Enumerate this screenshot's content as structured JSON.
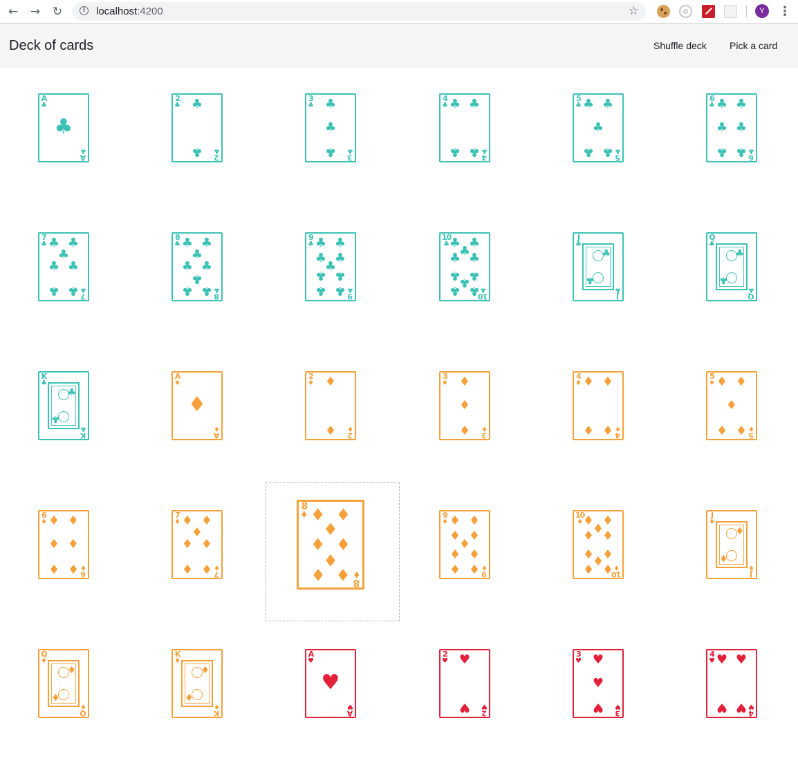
{
  "browser": {
    "url_host": "localhost",
    "url_port": ":4200",
    "avatar_initial": "Y",
    "icons": [
      "back-icon",
      "forward-icon",
      "reload-icon",
      "info-icon",
      "star-icon",
      "cookie-extension-icon",
      "target-extension-icon",
      "red-extension-icon",
      "grey-extension-icon",
      "menu-icon"
    ]
  },
  "app": {
    "title": "Deck of cards",
    "actions": {
      "shuffle": "Shuffle deck",
      "pick": "Pick a card"
    }
  },
  "suits": {
    "clubs": {
      "symbol": "♣",
      "color": "#3cc2b5"
    },
    "diamonds": {
      "symbol": "♦",
      "color": "#f6a03a"
    },
    "hearts": {
      "symbol": "♥",
      "color": "#e2203a"
    }
  },
  "selected_card": "8-diamonds",
  "cards": [
    {
      "rank": "A",
      "suit": "clubs"
    },
    {
      "rank": "2",
      "suit": "clubs"
    },
    {
      "rank": "3",
      "suit": "clubs"
    },
    {
      "rank": "4",
      "suit": "clubs"
    },
    {
      "rank": "5",
      "suit": "clubs"
    },
    {
      "rank": "6",
      "suit": "clubs"
    },
    {
      "rank": "7",
      "suit": "clubs"
    },
    {
      "rank": "8",
      "suit": "clubs"
    },
    {
      "rank": "9",
      "suit": "clubs"
    },
    {
      "rank": "10",
      "suit": "clubs"
    },
    {
      "rank": "J",
      "suit": "clubs"
    },
    {
      "rank": "Q",
      "suit": "clubs"
    },
    {
      "rank": "K",
      "suit": "clubs"
    },
    {
      "rank": "A",
      "suit": "diamonds"
    },
    {
      "rank": "2",
      "suit": "diamonds"
    },
    {
      "rank": "3",
      "suit": "diamonds"
    },
    {
      "rank": "4",
      "suit": "diamonds"
    },
    {
      "rank": "5",
      "suit": "diamonds"
    },
    {
      "rank": "6",
      "suit": "diamonds"
    },
    {
      "rank": "7",
      "suit": "diamonds"
    },
    {
      "rank": "8",
      "suit": "diamonds"
    },
    {
      "rank": "9",
      "suit": "diamonds"
    },
    {
      "rank": "10",
      "suit": "diamonds"
    },
    {
      "rank": "J",
      "suit": "diamonds"
    },
    {
      "rank": "Q",
      "suit": "diamonds"
    },
    {
      "rank": "K",
      "suit": "diamonds"
    },
    {
      "rank": "A",
      "suit": "hearts"
    },
    {
      "rank": "2",
      "suit": "hearts"
    },
    {
      "rank": "3",
      "suit": "hearts"
    },
    {
      "rank": "4",
      "suit": "hearts"
    }
  ]
}
